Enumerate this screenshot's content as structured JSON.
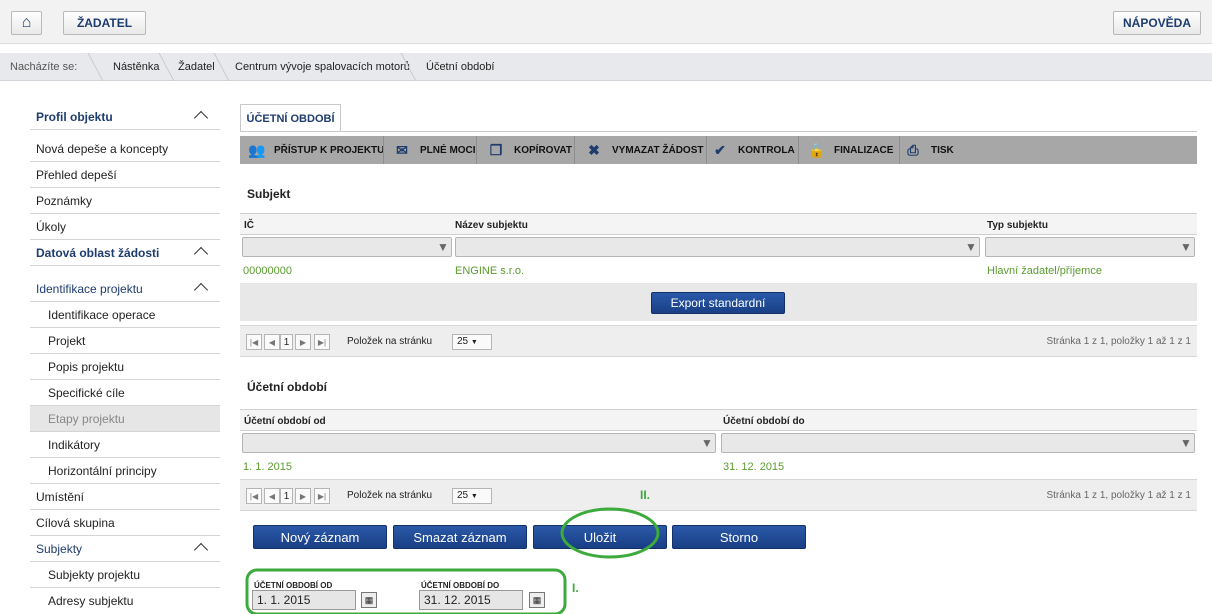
{
  "header": {
    "zadatel": "ŽADATEL",
    "help": "NÁPOVĚDA"
  },
  "breadcrumb": {
    "prefix": "Nacházíte se:",
    "items": [
      "Nástěnka",
      "Žadatel",
      "Centrum vývoje spalovacích motorů",
      "Účetní období"
    ]
  },
  "sidebar": {
    "items": [
      "Profil objektu",
      "Nová depeše a koncepty",
      "Přehled depeší",
      "Poznámky",
      "Úkoly",
      "Datová oblast žádosti",
      "Identifikace projektu",
      "Identifikace operace",
      "Projekt",
      "Popis projektu",
      "Specifické cíle",
      "Etapy projektu",
      "Indikátory",
      "Horizontální principy",
      "Umístění",
      "Cílová skupina",
      "Subjekty",
      "Subjekty projektu",
      "Adresy subjektu"
    ]
  },
  "tab": "ÚČETNÍ OBDOBÍ",
  "toolbar": [
    "PŘÍSTUP K PROJEKTU",
    "PLNÉ MOCI",
    "KOPÍROVAT",
    "VYMAZAT ŽÁDOST",
    "KONTROLA",
    "FINALIZACE",
    "TISK"
  ],
  "subjekt": {
    "title": "Subjekt",
    "headers": [
      "IČ",
      "Název subjektu",
      "Typ subjektu"
    ],
    "row": [
      "00000000",
      "ENGINE s.r.o.",
      "Hlavní žadatel/příjemce"
    ],
    "export": "Export standardní"
  },
  "pager": {
    "page": "1",
    "per_page_label": "Položek na stránku",
    "per_page": "25",
    "info1": "Stránka 1 z 1, položky 1 až 1 z 1"
  },
  "obdobi": {
    "title": "Účetní období",
    "headers": [
      "Účetní období od",
      "Účetní období do"
    ],
    "row": [
      "1. 1. 2015",
      "31. 12. 2015"
    ]
  },
  "buttons": [
    "Nový záznam",
    "Smazat záznam",
    "Uložit",
    "Storno"
  ],
  "form": {
    "od_label": "ÚČETNÍ OBDOBÍ OD",
    "od_value": "1. 1. 2015",
    "do_label": "ÚČETNÍ OBDOBÍ DO",
    "do_value": "31. 12. 2015"
  },
  "notes": {
    "n1": "I.",
    "n2": "II."
  },
  "colors": {
    "accent": "#1e3c6e",
    "green": "#5b9b2f",
    "annotation": "#3caa3c"
  }
}
